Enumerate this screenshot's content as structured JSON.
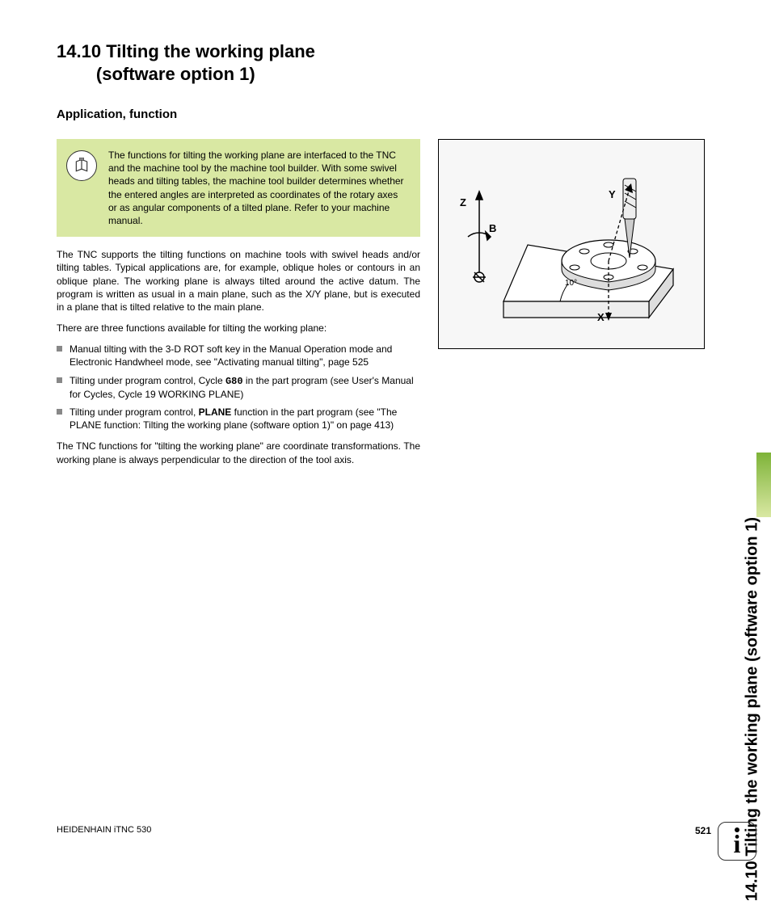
{
  "section": {
    "number": "14.10",
    "title_line1": "Tilting the working plane",
    "title_line2": "(software option 1)"
  },
  "subsection": "Application, function",
  "note": "The functions for tilting the working plane are interfaced to the TNC and the machine tool by the machine tool builder. With some swivel heads and tilting tables, the machine tool builder determines whether the entered angles are interpreted as coordinates of the rotary axes or as angular components of a tilted plane. Refer to your machine manual.",
  "para1": "The TNC supports the tilting functions on machine tools with swivel heads and/or tilting tables. Typical applications are, for example, oblique holes or contours in an oblique plane. The working plane is always tilted around the active datum. The program is written as usual in a main plane, such as the X/Y plane, but is executed in a plane that is tilted relative to the main plane.",
  "para2": "There are three functions available for tilting the working plane:",
  "list": {
    "item1": "Manual tilting with the 3-D ROT soft key in the Manual Operation mode and Electronic Handwheel mode, see \"Activating manual tilting\", page 525",
    "item2_pre": "Tilting under program control, Cycle ",
    "item2_code": "G80",
    "item2_post": " in the part program (see User's Manual for Cycles, Cycle 19 WORKING PLANE)",
    "item3_pre": "Tilting under program control, ",
    "item3_bold": "PLANE",
    "item3_post": " function in the part program (see \"The PLANE function: Tilting the working plane (software option 1)\" on page 413)"
  },
  "para3": "The TNC functions for \"tilting the working plane\" are coordinate transformations. The working plane is always perpendicular to the direction of the tool axis.",
  "diagram": {
    "Z": "Z",
    "B": "B",
    "Y": "Y",
    "X": "X",
    "angle": "10°"
  },
  "sidetab": "14.10 Tilting the working plane (software option 1)",
  "footer": {
    "left": "HEIDENHAIN iTNC 530",
    "page": "521"
  },
  "info_glyph": "i"
}
